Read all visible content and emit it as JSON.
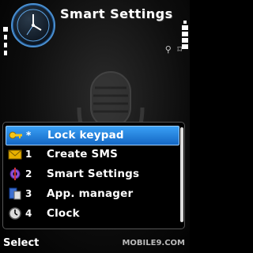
{
  "header": {
    "title": "Smart Settings"
  },
  "status": {
    "icons": "⚲ ⌑"
  },
  "menu": {
    "items": [
      {
        "num": "*",
        "label": "Lock keypad",
        "icon": "key-icon",
        "selected": true
      },
      {
        "num": "1",
        "label": "Create SMS",
        "icon": "envelope-icon"
      },
      {
        "num": "2",
        "label": "Smart Settings",
        "icon": "settings-icon"
      },
      {
        "num": "3",
        "label": "App. manager",
        "icon": "app-manager-icon"
      },
      {
        "num": "4",
        "label": "Clock",
        "icon": "clock-icon"
      }
    ]
  },
  "softkeys": {
    "left": "Select"
  },
  "watermark": "MOBILE9.COM",
  "colors": {
    "accent": "#1e7fe0",
    "selection_top": "#3aa0f5",
    "selection_bottom": "#1467c4"
  }
}
